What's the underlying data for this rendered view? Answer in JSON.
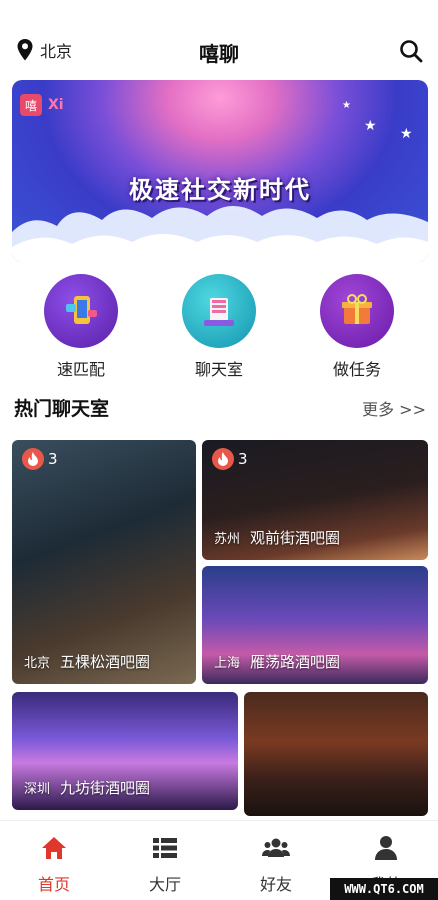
{
  "header": {
    "location": "北京",
    "title": "嘻聊"
  },
  "banner": {
    "brand_mark": "嘻",
    "brand_text": "Xi",
    "headline": "极速社交新时代"
  },
  "quick_entries": [
    {
      "label": "速匹配",
      "icon": "phone-match-icon",
      "color": "#6a2ec0"
    },
    {
      "label": "聊天室",
      "icon": "chat-room-icon",
      "color": "#1fb6c9"
    },
    {
      "label": "做任务",
      "icon": "gift-task-icon",
      "color": "#8a2fc4"
    }
  ],
  "section": {
    "title": "热门聊天室",
    "more": "更多 >>"
  },
  "rooms": [
    {
      "city": "北京",
      "name": "五棵松酒吧圈",
      "hot": "3"
    },
    {
      "city": "苏州",
      "name": "观前街酒吧圈",
      "hot": "3"
    },
    {
      "city": "上海",
      "name": "雁荡路酒吧圈",
      "hot": ""
    },
    {
      "city": "深圳",
      "name": "九坊街酒吧圈",
      "hot": ""
    },
    {
      "city": "",
      "name": "",
      "hot": ""
    }
  ],
  "tabs": [
    {
      "label": "首页",
      "icon": "home-icon",
      "active": true
    },
    {
      "label": "大厅",
      "icon": "list-icon",
      "active": false
    },
    {
      "label": "好友",
      "icon": "friends-icon",
      "active": false
    },
    {
      "label": "我的",
      "icon": "person-icon",
      "active": false
    }
  ],
  "watermark": "WWW.QT6.COM",
  "colors": {
    "accent": "#e0372d",
    "banner_base": "#3a3cc8",
    "flame": "#e8584a"
  }
}
